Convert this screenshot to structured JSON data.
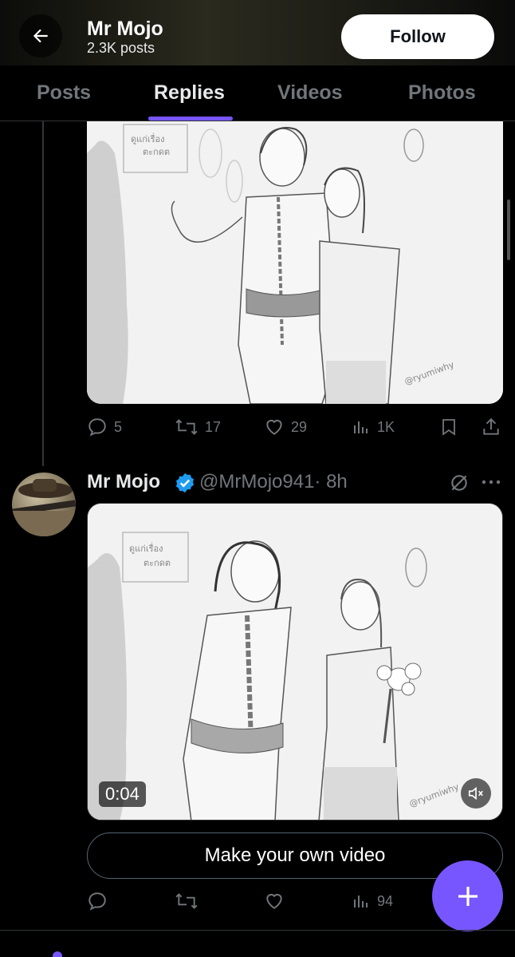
{
  "header": {
    "name": "Mr Mojo",
    "post_count": "2.3K posts",
    "follow_label": "Follow"
  },
  "tabs": [
    {
      "label": "Posts",
      "active": false
    },
    {
      "label": "Replies",
      "active": true
    },
    {
      "label": "Videos",
      "active": false
    },
    {
      "label": "Photos",
      "active": false
    }
  ],
  "post1": {
    "media": {
      "sketch_signature": "@ryumiwhy",
      "sketch_text": [
        "ดูแก่เรื่อง",
        "ตะกดต"
      ]
    },
    "stats": {
      "replies": "5",
      "reposts": "17",
      "likes": "29",
      "views": "1K"
    }
  },
  "post2": {
    "author": "Mr Mojo",
    "handle": "@MrMojo941",
    "time": "· 8h",
    "media": {
      "duration": "0:04",
      "sketch_signature": "@ryumiwhy",
      "sketch_text": [
        "ดูแก่เรื่อง",
        "ตะกดต"
      ]
    },
    "make_video_label": "Make your own video",
    "stats": {
      "replies": "",
      "reposts": "",
      "likes": "",
      "views": "94"
    }
  },
  "colors": {
    "accent": "#7856ff",
    "verified": "#1d9bf0",
    "muted": "#71767b"
  },
  "icons": [
    "back-arrow-icon",
    "reply-icon",
    "repost-icon",
    "like-icon",
    "views-icon",
    "bookmark-icon",
    "share-icon",
    "verified-icon",
    "grok-icon",
    "more-icon",
    "mute-icon",
    "plus-icon"
  ]
}
